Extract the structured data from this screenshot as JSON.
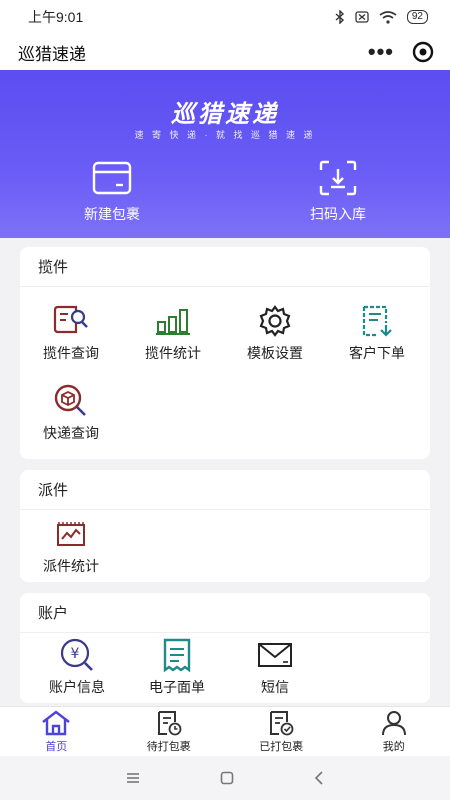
{
  "status_bar": {
    "time": "上午9:01",
    "battery": "92"
  },
  "title_bar": {
    "title": "巡猎速递"
  },
  "banner": {
    "brand": "巡猎速递",
    "slogan": "速 寄 快 递 · 就 找 巡 猎 速 递",
    "actions": [
      {
        "label": "新建包裹",
        "icon": "package-box-icon"
      },
      {
        "label": "扫码入库",
        "icon": "scan-icon"
      }
    ]
  },
  "sections": {
    "pickup": {
      "title": "揽件",
      "items": [
        {
          "label": "揽件查询",
          "icon": "pickup-search-icon"
        },
        {
          "label": "揽件统计",
          "icon": "bar-chart-icon"
        },
        {
          "label": "模板设置",
          "icon": "gear-icon"
        },
        {
          "label": "客户下单",
          "icon": "order-clipboard-icon"
        },
        {
          "label": "快递查询",
          "icon": "parcel-search-icon"
        }
      ]
    },
    "delivery": {
      "title": "派件",
      "items": [
        {
          "label": "派件统计",
          "icon": "line-chart-icon"
        }
      ]
    },
    "account": {
      "title": "账户",
      "items": [
        {
          "label": "账户信息",
          "icon": "yuan-search-icon"
        },
        {
          "label": "电子面单",
          "icon": "receipt-icon"
        },
        {
          "label": "短信",
          "icon": "envelope-icon"
        }
      ]
    }
  },
  "tabbar": {
    "items": [
      {
        "label": "首页",
        "icon": "home-icon"
      },
      {
        "label": "待打包裹",
        "icon": "pending-print-icon"
      },
      {
        "label": "已打包裹",
        "icon": "printed-icon"
      },
      {
        "label": "我的",
        "icon": "user-icon"
      }
    ]
  },
  "colors": {
    "banner": "#5b4df0",
    "accent_red": "#8b2c2c",
    "accent_green": "#2e7d32",
    "accent_teal": "#1f8a8a",
    "accent_purple": "#4e43d8"
  }
}
